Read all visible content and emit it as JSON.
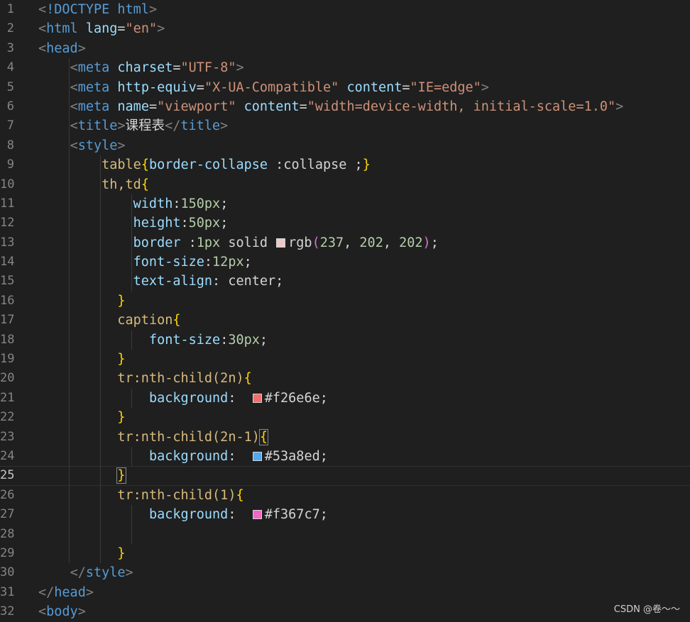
{
  "editor": {
    "lines": [
      {
        "n": "1",
        "tokens": [
          [
            "tag-br",
            "<"
          ],
          [
            "tag",
            "!DOCTYPE"
          ],
          [
            "txt",
            " "
          ],
          [
            "tag",
            "html"
          ],
          [
            "tag-br",
            ">"
          ]
        ]
      },
      {
        "n": "2",
        "tokens": [
          [
            "tag-br",
            "<"
          ],
          [
            "tag",
            "html"
          ],
          [
            "txt",
            " "
          ],
          [
            "attr",
            "lang"
          ],
          [
            "txt",
            "="
          ],
          [
            "str",
            "\"en\""
          ],
          [
            "tag-br",
            ">"
          ]
        ]
      },
      {
        "n": "3",
        "tokens": [
          [
            "tag-br",
            "<"
          ],
          [
            "tag",
            "head"
          ],
          [
            "tag-br",
            ">"
          ]
        ]
      },
      {
        "n": "4",
        "tokens": [
          [
            "txt",
            "    "
          ],
          [
            "tag-br",
            "<"
          ],
          [
            "tag",
            "meta"
          ],
          [
            "txt",
            " "
          ],
          [
            "attr",
            "charset"
          ],
          [
            "txt",
            "="
          ],
          [
            "str",
            "\"UTF-8\""
          ],
          [
            "tag-br",
            ">"
          ]
        ]
      },
      {
        "n": "5",
        "tokens": [
          [
            "txt",
            "    "
          ],
          [
            "tag-br",
            "<"
          ],
          [
            "tag",
            "meta"
          ],
          [
            "txt",
            " "
          ],
          [
            "attr",
            "http-equiv"
          ],
          [
            "txt",
            "="
          ],
          [
            "str",
            "\"X-UA-Compatible\""
          ],
          [
            "txt",
            " "
          ],
          [
            "attr",
            "content"
          ],
          [
            "txt",
            "="
          ],
          [
            "str",
            "\"IE=edge\""
          ],
          [
            "tag-br",
            ">"
          ]
        ]
      },
      {
        "n": "6",
        "tokens": [
          [
            "txt",
            "    "
          ],
          [
            "tag-br",
            "<"
          ],
          [
            "tag",
            "meta"
          ],
          [
            "txt",
            " "
          ],
          [
            "attr",
            "name"
          ],
          [
            "txt",
            "="
          ],
          [
            "str",
            "\"viewport\""
          ],
          [
            "txt",
            " "
          ],
          [
            "attr",
            "content"
          ],
          [
            "txt",
            "="
          ],
          [
            "str",
            "\"width=device-width, initial-scale=1.0\""
          ],
          [
            "tag-br",
            ">"
          ]
        ]
      },
      {
        "n": "7",
        "tokens": [
          [
            "txt",
            "    "
          ],
          [
            "tag-br",
            "<"
          ],
          [
            "tag",
            "title"
          ],
          [
            "tag-br",
            ">"
          ],
          [
            "txt",
            "课程表"
          ],
          [
            "tag-br",
            "</"
          ],
          [
            "tag",
            "title"
          ],
          [
            "tag-br",
            ">"
          ]
        ]
      },
      {
        "n": "8",
        "tokens": [
          [
            "txt",
            "    "
          ],
          [
            "tag-br",
            "<"
          ],
          [
            "tag",
            "style"
          ],
          [
            "tag-br",
            ">"
          ]
        ]
      },
      {
        "n": "9",
        "tokens": [
          [
            "txt",
            "        "
          ],
          [
            "sel",
            "table"
          ],
          [
            "br1",
            "{"
          ],
          [
            "prop",
            "border-collapse"
          ],
          [
            "txt",
            " :"
          ],
          [
            "txt",
            "collapse"
          ],
          [
            "txt",
            " ;"
          ],
          [
            "br1",
            "}"
          ]
        ]
      },
      {
        "n": "10",
        "tokens": [
          [
            "txt",
            "        "
          ],
          [
            "sel",
            "th,td"
          ],
          [
            "br1",
            "{"
          ]
        ]
      },
      {
        "n": "11",
        "tokens": [
          [
            "txt",
            "            "
          ],
          [
            "prop",
            "width"
          ],
          [
            "txt",
            ":"
          ],
          [
            "num",
            "150px"
          ],
          [
            "txt",
            ";"
          ]
        ]
      },
      {
        "n": "12",
        "tokens": [
          [
            "txt",
            "            "
          ],
          [
            "prop",
            "height"
          ],
          [
            "txt",
            ":"
          ],
          [
            "num",
            "50px"
          ],
          [
            "txt",
            ";"
          ]
        ]
      },
      {
        "n": "13",
        "tokens": [
          [
            "txt",
            "            "
          ],
          [
            "prop",
            "border"
          ],
          [
            "txt",
            " :"
          ],
          [
            "num",
            "1px"
          ],
          [
            "txt",
            " solid "
          ],
          [
            "swatch",
            "#ecc9c9"
          ],
          [
            "txt",
            "rgb"
          ],
          [
            "br2",
            "("
          ],
          [
            "num",
            "237"
          ],
          [
            "txt",
            ", "
          ],
          [
            "num",
            "202"
          ],
          [
            "txt",
            ", "
          ],
          [
            "num",
            "202"
          ],
          [
            "br2",
            ")"
          ],
          [
            "txt",
            ";"
          ]
        ]
      },
      {
        "n": "14",
        "tokens": [
          [
            "txt",
            "            "
          ],
          [
            "prop",
            "font-size"
          ],
          [
            "txt",
            ":"
          ],
          [
            "num",
            "12px"
          ],
          [
            "txt",
            ";"
          ]
        ]
      },
      {
        "n": "15",
        "tokens": [
          [
            "txt",
            "            "
          ],
          [
            "prop",
            "text-align"
          ],
          [
            "txt",
            ": center;"
          ]
        ]
      },
      {
        "n": "16",
        "tokens": [
          [
            "txt",
            "          "
          ],
          [
            "br1",
            "}"
          ]
        ]
      },
      {
        "n": "17",
        "tokens": [
          [
            "txt",
            "          "
          ],
          [
            "sel",
            "caption"
          ],
          [
            "br1",
            "{"
          ]
        ]
      },
      {
        "n": "18",
        "tokens": [
          [
            "txt",
            "              "
          ],
          [
            "prop",
            "font-size"
          ],
          [
            "txt",
            ":"
          ],
          [
            "num",
            "30px"
          ],
          [
            "txt",
            ";"
          ]
        ]
      },
      {
        "n": "19",
        "tokens": [
          [
            "txt",
            "          "
          ],
          [
            "br1",
            "}"
          ]
        ]
      },
      {
        "n": "20",
        "tokens": [
          [
            "txt",
            "          "
          ],
          [
            "sel",
            "tr:nth-child(2n)"
          ],
          [
            "br1",
            "{"
          ]
        ]
      },
      {
        "n": "21",
        "tokens": [
          [
            "txt",
            "              "
          ],
          [
            "prop",
            "background"
          ],
          [
            "txt",
            ":  "
          ],
          [
            "swatch",
            "#f26e6e"
          ],
          [
            "txt",
            "#f26e6e;"
          ]
        ]
      },
      {
        "n": "22",
        "tokens": [
          [
            "txt",
            "          "
          ],
          [
            "br1",
            "}"
          ]
        ]
      },
      {
        "n": "23",
        "tokens": [
          [
            "txt",
            "          "
          ],
          [
            "sel",
            "tr:nth-child(2n-1)"
          ],
          [
            "br1cur",
            "{"
          ]
        ]
      },
      {
        "n": "24",
        "tokens": [
          [
            "txt",
            "              "
          ],
          [
            "prop",
            "background"
          ],
          [
            "txt",
            ":  "
          ],
          [
            "swatch",
            "#53a8ed"
          ],
          [
            "txt",
            "#53a8ed;"
          ]
        ]
      },
      {
        "n": "25",
        "active": true,
        "tokens": [
          [
            "txt",
            "          "
          ],
          [
            "br1cur",
            "}"
          ]
        ]
      },
      {
        "n": "26",
        "tokens": [
          [
            "txt",
            "          "
          ],
          [
            "sel",
            "tr:nth-child(1)"
          ],
          [
            "br1",
            "{"
          ]
        ]
      },
      {
        "n": "27",
        "tokens": [
          [
            "txt",
            "              "
          ],
          [
            "prop",
            "background"
          ],
          [
            "txt",
            ":  "
          ],
          [
            "swatch",
            "#f367c7"
          ],
          [
            "txt",
            "#f367c7;"
          ]
        ]
      },
      {
        "n": "28",
        "tokens": []
      },
      {
        "n": "29",
        "tokens": [
          [
            "txt",
            "          "
          ],
          [
            "br1",
            "}"
          ]
        ]
      },
      {
        "n": "30",
        "tokens": [
          [
            "txt",
            "    "
          ],
          [
            "tag-br",
            "</"
          ],
          [
            "tag",
            "style"
          ],
          [
            "tag-br",
            ">"
          ]
        ]
      },
      {
        "n": "31",
        "tokens": [
          [
            "tag-br",
            "</"
          ],
          [
            "tag",
            "head"
          ],
          [
            "tag-br",
            ">"
          ]
        ]
      },
      {
        "n": "32",
        "tokens": [
          [
            "tag-br",
            "<"
          ],
          [
            "tag",
            "body"
          ],
          [
            "tag-br",
            ">"
          ]
        ]
      }
    ]
  },
  "watermark": "CSDN @卷～～"
}
